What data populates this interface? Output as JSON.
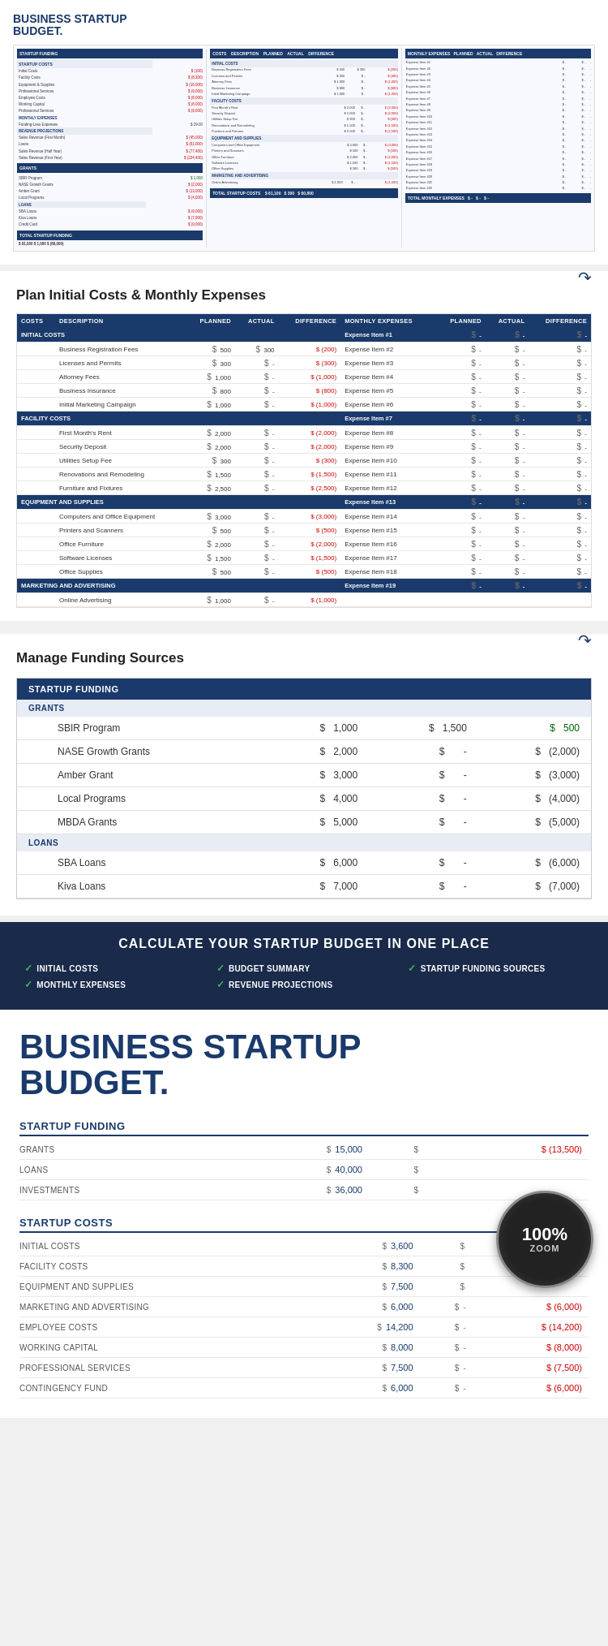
{
  "header": {
    "title_line1": "BUSINESS STARTUP",
    "title_line2": "BUDGET."
  },
  "section_plan": {
    "title": "Plan Initial Costs & Monthly Expenses",
    "col_headers": [
      "COSTS",
      "DESCRIPTION",
      "PLANNED",
      "ACTUAL",
      "DIFFERENCE",
      "MONTHLY EXPENSES",
      "PLANNED",
      "ACTUAL",
      "DIFFERENCE"
    ],
    "initial_costs": {
      "label": "INITIAL COSTS",
      "items": [
        {
          "name": "Business Registration Fees",
          "planned": "$ 500",
          "actual": "$ 300",
          "diff": "$ (200)"
        },
        {
          "name": "Licenses and Permits",
          "planned": "$ 300",
          "actual": "$ -",
          "diff": "$ (300)"
        },
        {
          "name": "Attorney Fees",
          "planned": "$ 1,000",
          "actual": "$ -",
          "diff": "$ (1,000)"
        },
        {
          "name": "Business Insurance",
          "planned": "$ 800",
          "actual": "$ -",
          "diff": "$ (800)"
        },
        {
          "name": "Initial Marketing Campaign",
          "planned": "$ 1,000",
          "actual": "$ -",
          "diff": "$ (1,000)"
        }
      ]
    },
    "facility_costs": {
      "label": "FACILITY COSTS",
      "items": [
        {
          "name": "First Month's Rent",
          "planned": "$ 2,000",
          "actual": "$ -",
          "diff": "$ (2,000)"
        },
        {
          "name": "Security Deposit",
          "planned": "$ 2,000",
          "actual": "$ -",
          "diff": "$ (2,000)"
        },
        {
          "name": "Utilities Setup Fee",
          "planned": "$ 300",
          "actual": "$ -",
          "diff": "$ (300)"
        },
        {
          "name": "Renovations and Remodeling",
          "planned": "$ 1,500",
          "actual": "$ -",
          "diff": "$ (1,500)"
        },
        {
          "name": "Furniture and Fixtures",
          "planned": "$ 2,500",
          "actual": "$ -",
          "diff": "$ (2,500)"
        }
      ]
    },
    "equipment": {
      "label": "EQUIPMENT AND SUPPLIES",
      "items": [
        {
          "name": "Computers and Office Equipment",
          "planned": "$ 3,000",
          "actual": "$ -",
          "diff": "$ (3,000)"
        },
        {
          "name": "Printers and Scanners",
          "planned": "$ 500",
          "actual": "$ -",
          "diff": "$ (500)"
        },
        {
          "name": "Office Furniture",
          "planned": "$ 2,000",
          "actual": "$ -",
          "diff": "$ (2,000)"
        },
        {
          "name": "Software Licenses",
          "planned": "$ 1,500",
          "actual": "$ -",
          "diff": "$ (1,500)"
        },
        {
          "name": "Office Supplies",
          "planned": "$ 500",
          "actual": "$ -",
          "diff": "$ (500)"
        }
      ]
    },
    "marketing": {
      "label": "MARKETING AND ADVERTISING",
      "items": [
        {
          "name": "Online Advertising",
          "planned": "$ 1,000",
          "actual": "$ -",
          "diff": "$ (1,000)"
        }
      ]
    },
    "monthly_items": [
      "Expense Item #1",
      "Expense Item #2",
      "Expense Item #3",
      "Expense Item #4",
      "Expense Item #5",
      "Expense Item #6",
      "Expense Item #7",
      "Expense Item #8",
      "Expense Item #9",
      "Expense Item #10",
      "Expense Item #11",
      "Expense Item #12",
      "Expense Item #13",
      "Expense Item #14",
      "Expense Item #15",
      "Expense Item #16",
      "Expense Item #17",
      "Expense Item #18",
      "Expense Item #19"
    ]
  },
  "section_funding": {
    "title": "Manage Funding Sources",
    "table_header": "STARTUP FUNDING",
    "grants_label": "GRANTS",
    "loans_label": "LOANS",
    "col_headers": [
      "",
      "PLANNED",
      "ACTUAL",
      "DIFFERENCE"
    ],
    "grants": [
      {
        "name": "SBIR Program",
        "planned": "$ 1,000",
        "actual": "$ 1,500",
        "diff": "$ 500"
      },
      {
        "name": "NASE Growth Grants",
        "planned": "$ 2,000",
        "actual": "$ -",
        "diff": "$ (2,000)"
      },
      {
        "name": "Amber Grant",
        "planned": "$ 3,000",
        "actual": "$ -",
        "diff": "$ (3,000)"
      },
      {
        "name": "Local Programs",
        "planned": "$ 4,000",
        "actual": "$ -",
        "diff": "$ (4,000)"
      },
      {
        "name": "MBDA Grants",
        "planned": "$ 5,000",
        "actual": "$ -",
        "diff": "$ (5,000)"
      }
    ],
    "loans": [
      {
        "name": "SBA Loans",
        "planned": "$ 6,000",
        "actual": "$ -",
        "diff": "$ (6,000)"
      },
      {
        "name": "Kiva Loans",
        "planned": "$ 7,000",
        "actual": "$ -",
        "diff": "$ (7,000)"
      }
    ]
  },
  "section_banner": {
    "main_text": "CALCULATE YOUR STARTUP BUDGET IN ONE PLACE",
    "features": [
      {
        "label": "INITIAL COSTS"
      },
      {
        "label": "MONTHLY EXPENSES"
      },
      {
        "label": "BUDGET SUMMARY"
      },
      {
        "label": "REVENUE PROJECTIONS"
      },
      {
        "label": "STARTUP FUNDING SOURCES"
      }
    ]
  },
  "section_main": {
    "title_line1": "BUSINESS STARTUP",
    "title_line2": "BUDGET.",
    "startup_funding_header": "STARTUP FUNDING",
    "funding_rows": [
      {
        "label": "GRANTS",
        "planned": "$ 15,000",
        "actual": "$",
        "diff": "$ (13,500)"
      },
      {
        "label": "LOANS",
        "planned": "$ 40,000",
        "actual": "$",
        "diff": ""
      },
      {
        "label": "INVESTMENTS",
        "planned": "$ 36,000",
        "actual": "$",
        "diff": ""
      }
    ],
    "startup_costs_header": "STARTUP COSTS",
    "costs_rows": [
      {
        "label": "INITIAL COSTS",
        "planned": "$ 3,600",
        "actual": "$",
        "diff": ""
      },
      {
        "label": "FACILITY COSTS",
        "planned": "$ 8,300",
        "actual": "$",
        "diff": ""
      },
      {
        "label": "EQUIPMENT AND SUPPLIES",
        "planned": "$ 7,500",
        "actual": "$",
        "diff": ""
      },
      {
        "label": "MARKETING AND ADVERTISING",
        "planned": "$ 6,000",
        "actual": "$ -",
        "diff": "$ (6,000)"
      },
      {
        "label": "EMPLOYEE COSTS",
        "planned": "$ 14,200",
        "actual": "$ -",
        "diff": "$ (14,200)"
      },
      {
        "label": "WORKING CAPITAL",
        "planned": "$ 8,000",
        "actual": "$ -",
        "diff": "$ (8,000)"
      },
      {
        "label": "PROFESSIONAL SERVICES",
        "planned": "$ 7,500",
        "actual": "$ -",
        "diff": "$ (7,500)"
      },
      {
        "label": "CONTINGENCY FUND",
        "planned": "$ 6,000",
        "actual": "$ -",
        "diff": "$ (6,000)"
      }
    ],
    "zoom_text": "100%",
    "zoom_label": "ZOOM"
  }
}
